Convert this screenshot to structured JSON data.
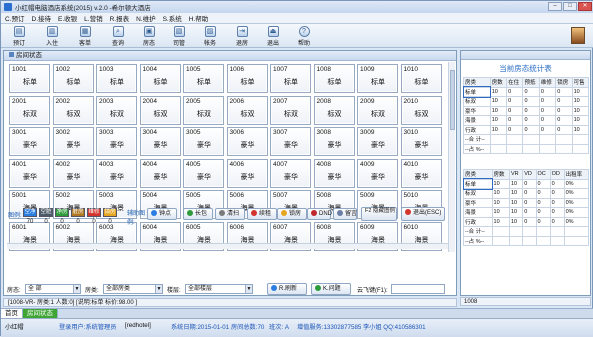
{
  "window": {
    "title": "小红帽电脑酒店系统(2015) v.2.0 -希尔顿大酒店"
  },
  "menu": [
    "C.预订",
    "D.接待",
    "E.收银",
    "L.营销",
    "R.报表",
    "N.维护",
    "S.系统",
    "H.帮助"
  ],
  "toolbar": [
    {
      "label": "预订",
      "icon": "book-icon"
    },
    {
      "label": "入住",
      "icon": "checkin-icon"
    },
    {
      "label": "客单",
      "icon": "guest-bill-icon"
    },
    {
      "label": "查询",
      "icon": "search-icon"
    },
    {
      "label": "房态",
      "icon": "room-status-icon"
    },
    {
      "label": "司管",
      "icon": "manage-icon"
    },
    {
      "label": "帐务",
      "icon": "account-icon"
    },
    {
      "label": "退房",
      "icon": "checkout-icon"
    },
    {
      "label": "退出",
      "icon": "exit-icon"
    },
    {
      "label": "帮助",
      "icon": "help-icon"
    }
  ],
  "room_panel": {
    "title": "房间状态"
  },
  "rooms": [
    [
      "1001",
      "标单"
    ],
    [
      "1002",
      "标单"
    ],
    [
      "1003",
      "标单"
    ],
    [
      "1004",
      "标单"
    ],
    [
      "1005",
      "标单"
    ],
    [
      "1006",
      "标单"
    ],
    [
      "1007",
      "标单"
    ],
    [
      "1008",
      "标单"
    ],
    [
      "1009",
      "标单"
    ],
    [
      "1010",
      "标单"
    ],
    [
      "2001",
      "标双"
    ],
    [
      "2002",
      "标双"
    ],
    [
      "2003",
      "标双"
    ],
    [
      "2004",
      "标双"
    ],
    [
      "2005",
      "标双"
    ],
    [
      "2006",
      "标双"
    ],
    [
      "2007",
      "标双"
    ],
    [
      "2008",
      "标双"
    ],
    [
      "2009",
      "标双"
    ],
    [
      "2010",
      "标双"
    ],
    [
      "3001",
      "豪华"
    ],
    [
      "3002",
      "豪华"
    ],
    [
      "3003",
      "豪华"
    ],
    [
      "3004",
      "豪华"
    ],
    [
      "3005",
      "豪华"
    ],
    [
      "3006",
      "豪华"
    ],
    [
      "3007",
      "豪华"
    ],
    [
      "3008",
      "豪华"
    ],
    [
      "3009",
      "豪华"
    ],
    [
      "3010",
      "豪华"
    ],
    [
      "4001",
      "豪华"
    ],
    [
      "4002",
      "豪华"
    ],
    [
      "4003",
      "豪华"
    ],
    [
      "4004",
      "豪华"
    ],
    [
      "4005",
      "豪华"
    ],
    [
      "4006",
      "豪华"
    ],
    [
      "4007",
      "豪华"
    ],
    [
      "4008",
      "豪华"
    ],
    [
      "4009",
      "豪华"
    ],
    [
      "4010",
      "豪华"
    ],
    [
      "5001",
      "海景"
    ],
    [
      "5002",
      "海景"
    ],
    [
      "5003",
      "海景"
    ],
    [
      "5004",
      "海景"
    ],
    [
      "5005",
      "海景"
    ],
    [
      "5006",
      "海景"
    ],
    [
      "5007",
      "海景"
    ],
    [
      "5008",
      "海景"
    ],
    [
      "5009",
      "海景"
    ],
    [
      "5010",
      "海景"
    ],
    [
      "6001",
      "海景"
    ],
    [
      "6002",
      "海景"
    ],
    [
      "6003",
      "海景"
    ],
    [
      "6004",
      "海景"
    ],
    [
      "6005",
      "海景"
    ],
    [
      "6006",
      "海景"
    ],
    [
      "6007",
      "海景"
    ],
    [
      "6008",
      "海景"
    ],
    [
      "6009",
      "海景"
    ],
    [
      "6010",
      "海景"
    ]
  ],
  "legend": {
    "label": "图例:",
    "chips": [
      {
        "text": "空净",
        "color": "#2a7de1",
        "count": "70"
      },
      {
        "text": "空脏",
        "color": "#4c5966",
        "count": "0"
      },
      {
        "text": "净房",
        "color": "#2e9b3a",
        "count": "0"
      },
      {
        "text": "脏房",
        "color": "#b07820",
        "count": "0"
      },
      {
        "text": "维修",
        "color": "#d3342b",
        "count": "0"
      },
      {
        "text": "锁房",
        "color": "#e6a51e",
        "count": "0"
      }
    ],
    "aux_label": "辅助图例:",
    "buttons": [
      {
        "text": "钟点",
        "color": "#2a7de1"
      },
      {
        "text": "长包",
        "color": "#2e9b3a"
      },
      {
        "text": "清扫",
        "color": "#7a7a7a"
      },
      {
        "text": "续租",
        "color": "#d3342b"
      },
      {
        "text": "锁房",
        "color": "#e6a51e"
      },
      {
        "text": "DND",
        "color": "#c0262c"
      },
      {
        "text": "留言",
        "color": "#6a7fa5"
      }
    ],
    "hide_btn": "F2 隐藏图例",
    "exit_btn": "退出(ESC)"
  },
  "filters": {
    "floor_label": "房态:",
    "floor_value": "全    部",
    "type_label": "房类:",
    "type_value": "全部房类",
    "building_label": "楼层:",
    "building_value": "全部楼层",
    "refresh": "R.刷新",
    "query": "K.问题",
    "cloud_label": "云飞键(F1):"
  },
  "info": "[1008-VR- 房类:1 人数:0] [说明:标单     标价:98.00 ]",
  "stats": {
    "title": "当前房态统计表",
    "headers1": [
      "房类",
      "房数",
      "在住",
      "预抵",
      "维修",
      "锁房",
      "可售"
    ],
    "rows1": [
      [
        "标单",
        "10",
        "0",
        "0",
        "0",
        "0",
        "10"
      ],
      [
        "标双",
        "10",
        "0",
        "0",
        "0",
        "0",
        "10"
      ],
      [
        "豪华",
        "10",
        "0",
        "0",
        "0",
        "0",
        "10"
      ],
      [
        "海景",
        "10",
        "0",
        "0",
        "0",
        "0",
        "10"
      ],
      [
        "行政",
        "10",
        "0",
        "0",
        "0",
        "0",
        "10"
      ],
      [
        "--合 计--",
        "",
        "",
        "",
        "",
        "",
        ""
      ],
      [
        "--占 %--",
        "",
        "",
        "",
        "",
        "",
        ""
      ]
    ],
    "headers2": [
      "房类",
      "房数",
      "VR",
      "VD",
      "OC",
      "OD",
      "出租率"
    ],
    "rows2": [
      [
        "标单",
        "10",
        "10",
        "0",
        "0",
        "0",
        "0%"
      ],
      [
        "标双",
        "10",
        "10",
        "0",
        "0",
        "0",
        "0%"
      ],
      [
        "豪华",
        "10",
        "10",
        "0",
        "0",
        "0",
        "0%"
      ],
      [
        "海景",
        "10",
        "10",
        "0",
        "0",
        "0",
        "0%"
      ],
      [
        "行政",
        "10",
        "10",
        "0",
        "0",
        "0",
        "0%"
      ],
      [
        "--合 计--",
        "",
        "",
        "",
        "",
        "",
        ""
      ],
      [
        "--占 %--",
        "",
        "",
        "",
        "",
        "",
        ""
      ]
    ],
    "footer": "1008"
  },
  "tabs": [
    "首页",
    "房间状态"
  ],
  "status": {
    "user_tag": "小红帽",
    "login": "登录用户:系统管理员",
    "code": "[redhotel]",
    "date": "系统日期:2015-01-01",
    "rooms_total": "房间总数:70",
    "shift": "班次: A",
    "service": "增值服务:13302877585",
    "qq": "李小姐   QQ:410586301"
  }
}
